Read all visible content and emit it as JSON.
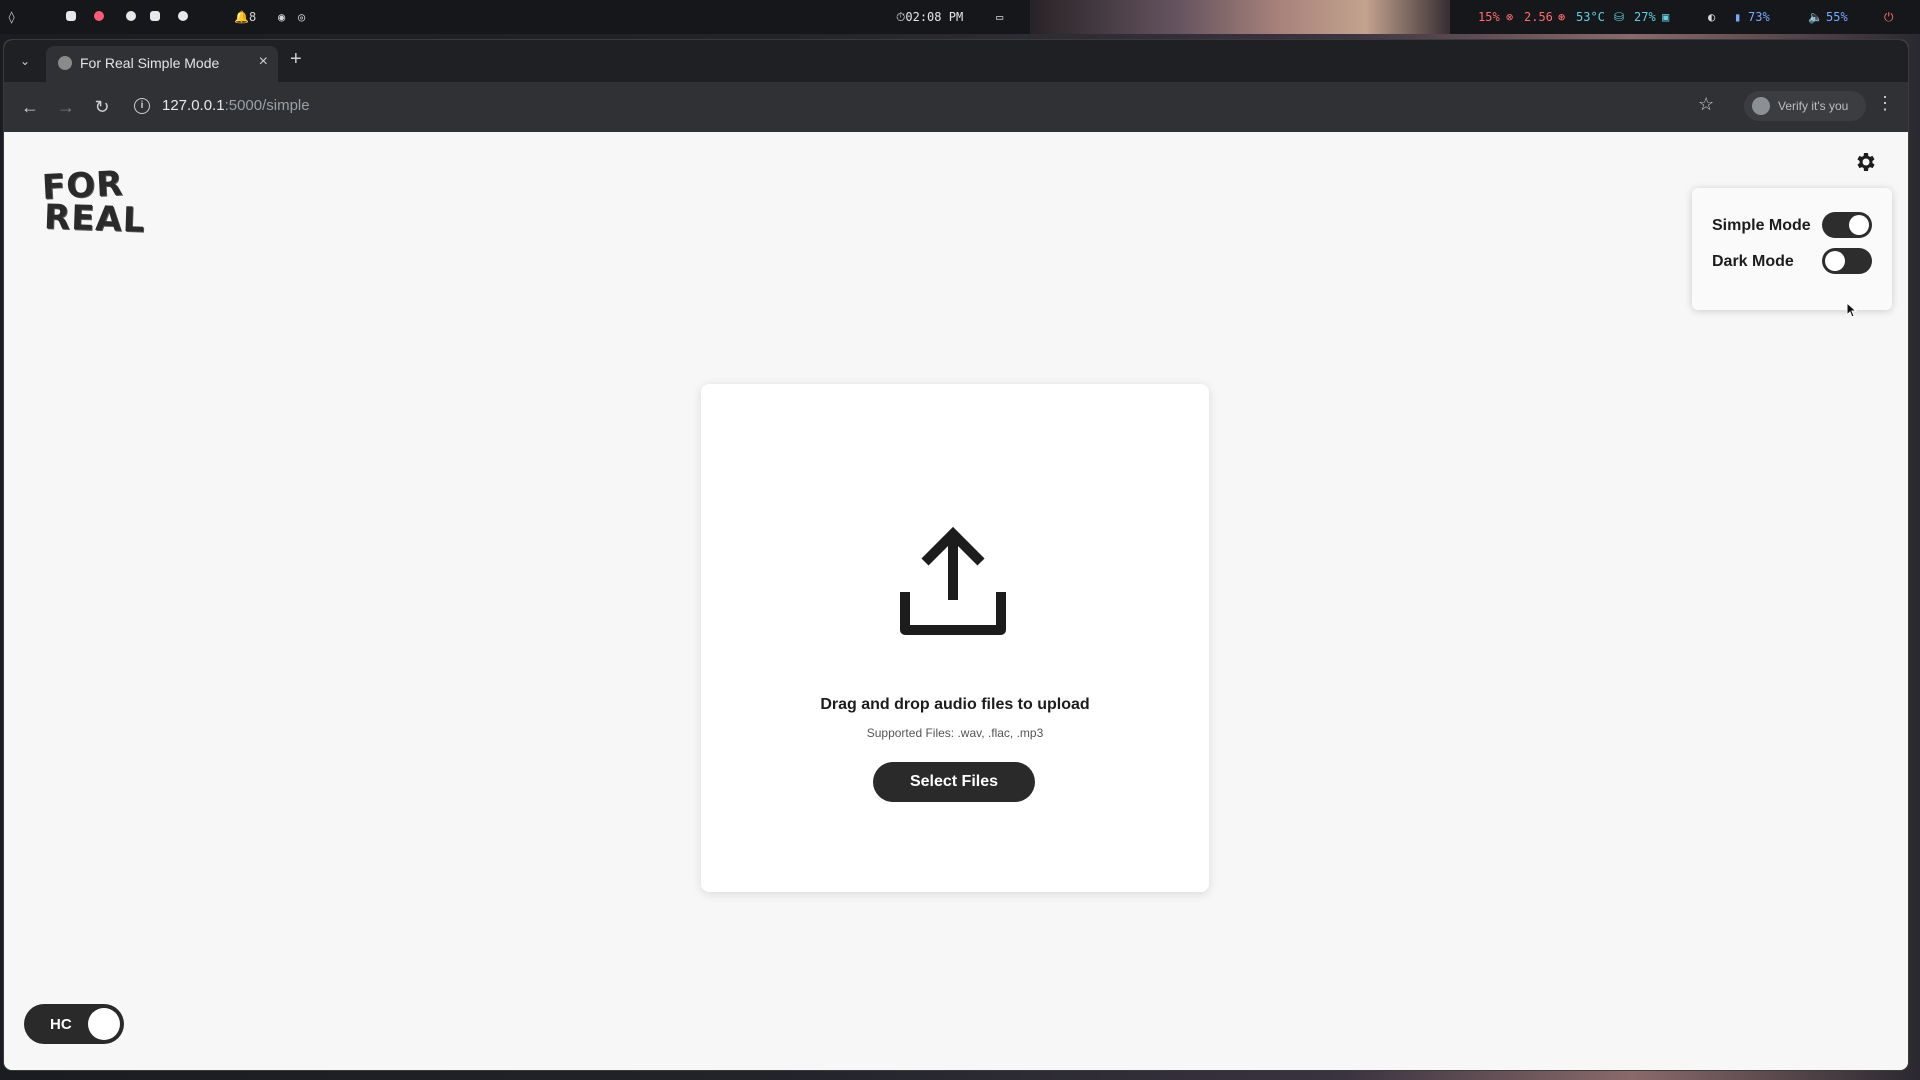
{
  "os_bar": {
    "notifications": "8",
    "clock": "02:08 PM",
    "cpu": "15%",
    "load": "2.56",
    "temp": "53°C",
    "disk": "27%",
    "battery": "73%",
    "volume": "55%"
  },
  "browser": {
    "tab_title": "For Real Simple Mode",
    "url_host": "127.0.0.1",
    "url_path": ":5000/simple",
    "verify_label": "Verify it's you"
  },
  "page": {
    "logo_line1": "FOR",
    "logo_line2": "REAL",
    "settings": {
      "simple_mode_label": "Simple Mode",
      "simple_mode_on": true,
      "dark_mode_label": "Dark Mode",
      "dark_mode_on": false
    },
    "upload": {
      "heading": "Drag and drop audio files to upload",
      "supported": "Supported Files: .wav, .flac, .mp3",
      "button_label": "Select Files"
    },
    "hc_toggle_label": "HC"
  },
  "colors": {
    "accent_dark": "#2a2a2a",
    "page_bg": "#f7f7f7",
    "card_bg": "#ffffff"
  }
}
